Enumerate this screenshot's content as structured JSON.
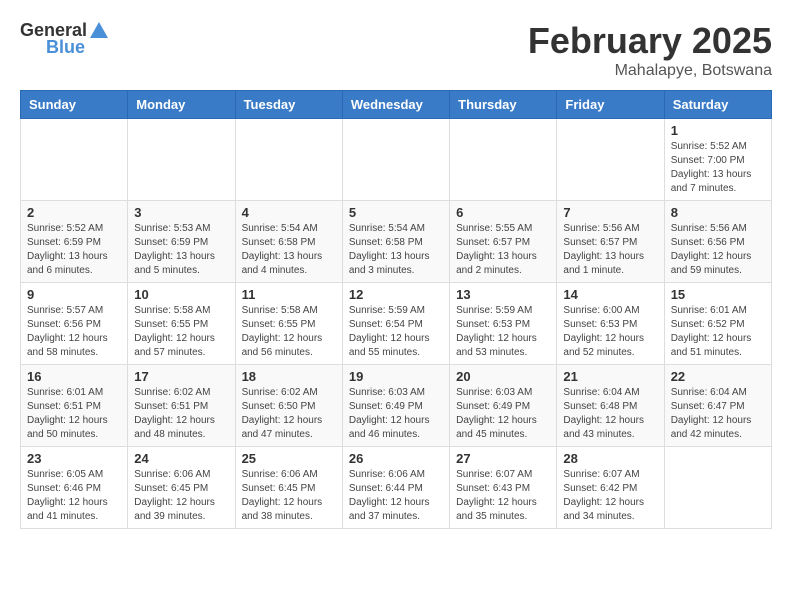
{
  "header": {
    "logo_general": "General",
    "logo_blue": "Blue",
    "month_year": "February 2025",
    "location": "Mahalapye, Botswana"
  },
  "days_of_week": [
    "Sunday",
    "Monday",
    "Tuesday",
    "Wednesday",
    "Thursday",
    "Friday",
    "Saturday"
  ],
  "weeks": [
    [
      {
        "day": "",
        "info": ""
      },
      {
        "day": "",
        "info": ""
      },
      {
        "day": "",
        "info": ""
      },
      {
        "day": "",
        "info": ""
      },
      {
        "day": "",
        "info": ""
      },
      {
        "day": "",
        "info": ""
      },
      {
        "day": "1",
        "info": "Sunrise: 5:52 AM\nSunset: 7:00 PM\nDaylight: 13 hours\nand 7 minutes."
      }
    ],
    [
      {
        "day": "2",
        "info": "Sunrise: 5:52 AM\nSunset: 6:59 PM\nDaylight: 13 hours\nand 6 minutes."
      },
      {
        "day": "3",
        "info": "Sunrise: 5:53 AM\nSunset: 6:59 PM\nDaylight: 13 hours\nand 5 minutes."
      },
      {
        "day": "4",
        "info": "Sunrise: 5:54 AM\nSunset: 6:58 PM\nDaylight: 13 hours\nand 4 minutes."
      },
      {
        "day": "5",
        "info": "Sunrise: 5:54 AM\nSunset: 6:58 PM\nDaylight: 13 hours\nand 3 minutes."
      },
      {
        "day": "6",
        "info": "Sunrise: 5:55 AM\nSunset: 6:57 PM\nDaylight: 13 hours\nand 2 minutes."
      },
      {
        "day": "7",
        "info": "Sunrise: 5:56 AM\nSunset: 6:57 PM\nDaylight: 13 hours\nand 1 minute."
      },
      {
        "day": "8",
        "info": "Sunrise: 5:56 AM\nSunset: 6:56 PM\nDaylight: 12 hours\nand 59 minutes."
      }
    ],
    [
      {
        "day": "9",
        "info": "Sunrise: 5:57 AM\nSunset: 6:56 PM\nDaylight: 12 hours\nand 58 minutes."
      },
      {
        "day": "10",
        "info": "Sunrise: 5:58 AM\nSunset: 6:55 PM\nDaylight: 12 hours\nand 57 minutes."
      },
      {
        "day": "11",
        "info": "Sunrise: 5:58 AM\nSunset: 6:55 PM\nDaylight: 12 hours\nand 56 minutes."
      },
      {
        "day": "12",
        "info": "Sunrise: 5:59 AM\nSunset: 6:54 PM\nDaylight: 12 hours\nand 55 minutes."
      },
      {
        "day": "13",
        "info": "Sunrise: 5:59 AM\nSunset: 6:53 PM\nDaylight: 12 hours\nand 53 minutes."
      },
      {
        "day": "14",
        "info": "Sunrise: 6:00 AM\nSunset: 6:53 PM\nDaylight: 12 hours\nand 52 minutes."
      },
      {
        "day": "15",
        "info": "Sunrise: 6:01 AM\nSunset: 6:52 PM\nDaylight: 12 hours\nand 51 minutes."
      }
    ],
    [
      {
        "day": "16",
        "info": "Sunrise: 6:01 AM\nSunset: 6:51 PM\nDaylight: 12 hours\nand 50 minutes."
      },
      {
        "day": "17",
        "info": "Sunrise: 6:02 AM\nSunset: 6:51 PM\nDaylight: 12 hours\nand 48 minutes."
      },
      {
        "day": "18",
        "info": "Sunrise: 6:02 AM\nSunset: 6:50 PM\nDaylight: 12 hours\nand 47 minutes."
      },
      {
        "day": "19",
        "info": "Sunrise: 6:03 AM\nSunset: 6:49 PM\nDaylight: 12 hours\nand 46 minutes."
      },
      {
        "day": "20",
        "info": "Sunrise: 6:03 AM\nSunset: 6:49 PM\nDaylight: 12 hours\nand 45 minutes."
      },
      {
        "day": "21",
        "info": "Sunrise: 6:04 AM\nSunset: 6:48 PM\nDaylight: 12 hours\nand 43 minutes."
      },
      {
        "day": "22",
        "info": "Sunrise: 6:04 AM\nSunset: 6:47 PM\nDaylight: 12 hours\nand 42 minutes."
      }
    ],
    [
      {
        "day": "23",
        "info": "Sunrise: 6:05 AM\nSunset: 6:46 PM\nDaylight: 12 hours\nand 41 minutes."
      },
      {
        "day": "24",
        "info": "Sunrise: 6:06 AM\nSunset: 6:45 PM\nDaylight: 12 hours\nand 39 minutes."
      },
      {
        "day": "25",
        "info": "Sunrise: 6:06 AM\nSunset: 6:45 PM\nDaylight: 12 hours\nand 38 minutes."
      },
      {
        "day": "26",
        "info": "Sunrise: 6:06 AM\nSunset: 6:44 PM\nDaylight: 12 hours\nand 37 minutes."
      },
      {
        "day": "27",
        "info": "Sunrise: 6:07 AM\nSunset: 6:43 PM\nDaylight: 12 hours\nand 35 minutes."
      },
      {
        "day": "28",
        "info": "Sunrise: 6:07 AM\nSunset: 6:42 PM\nDaylight: 12 hours\nand 34 minutes."
      },
      {
        "day": "",
        "info": ""
      }
    ]
  ]
}
